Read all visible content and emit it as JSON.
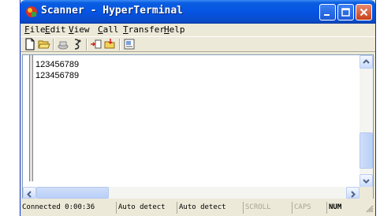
{
  "window": {
    "title": "Scanner - HyperTerminal",
    "icon": "hyperterminal-icon"
  },
  "menu": [
    {
      "key": "F",
      "rest": "ile"
    },
    {
      "key": "E",
      "rest": "dit"
    },
    {
      "key": "V",
      "rest": "iew"
    },
    {
      "key": "C",
      "rest": "all"
    },
    {
      "key": "T",
      "rest": "ransfer"
    },
    {
      "key": "H",
      "rest": "elp"
    }
  ],
  "toolbar": [
    "new-document-icon",
    "open-folder-icon",
    "call-icon",
    "disconnect-icon",
    "send-icon",
    "receive-icon",
    "properties-icon"
  ],
  "terminal": {
    "lines": [
      "123456789",
      "123456789"
    ]
  },
  "status": {
    "connected": "Connected 0:00:36",
    "detect1": "Auto detect",
    "detect2": "Auto detect",
    "scroll": "SCROLL",
    "caps": "CAPS",
    "num": "NUM"
  },
  "colors": {
    "titlebar": "#0554e3",
    "chrome": "#ece9d8",
    "close": "#c7401a"
  }
}
